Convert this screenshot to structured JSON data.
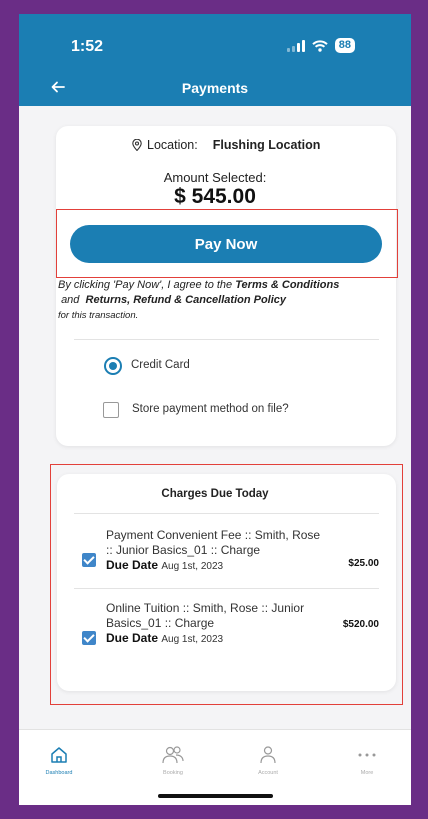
{
  "status_bar": {
    "time": "1:52",
    "battery": "88"
  },
  "header": {
    "title": "Payments",
    "back_icon": "arrow-left-icon"
  },
  "location": {
    "label": "Location:",
    "value": "Flushing Location",
    "icon": "map-pin-icon"
  },
  "amount": {
    "label": "Amount Selected:",
    "value": "$ 545.00"
  },
  "pay_button": {
    "label": "Pay Now"
  },
  "terms": {
    "part1": "By clicking 'Pay Now', I agree to the",
    "link1": "Terms & Conditions",
    "part2": "and",
    "link2": "Returns, Refund & Cancellation Policy",
    "part3": "for this transaction."
  },
  "payment_method": {
    "label": "Credit Card",
    "selected": true
  },
  "store_payment": {
    "label": "Store payment method on file?",
    "checked": false
  },
  "charges": {
    "title": "Charges Due Today",
    "items": [
      {
        "description": "Payment Convenient Fee :: Smith, Rose :: Junior Basics_01 :: Charge",
        "due_label": "Due Date",
        "due_date": "Aug 1st, 2023",
        "amount": "$25.00",
        "checked": true
      },
      {
        "description": "Online Tuition :: Smith, Rose :: Junior Basics_01 :: Charge",
        "due_label": "Due Date",
        "due_date": "Aug 1st, 2023",
        "amount": "$520.00",
        "checked": true
      }
    ]
  },
  "tabs": [
    {
      "label": "Dashboard",
      "icon": "home-icon",
      "active": true
    },
    {
      "label": "Booking",
      "icon": "users-icon",
      "active": false
    },
    {
      "label": "Account",
      "icon": "user-icon",
      "active": false
    },
    {
      "label": "More",
      "icon": "more-icon",
      "active": false
    }
  ],
  "colors": {
    "primary": "#1b7eb3",
    "highlight_border": "#e2403a",
    "frame": "#6a2d86"
  }
}
